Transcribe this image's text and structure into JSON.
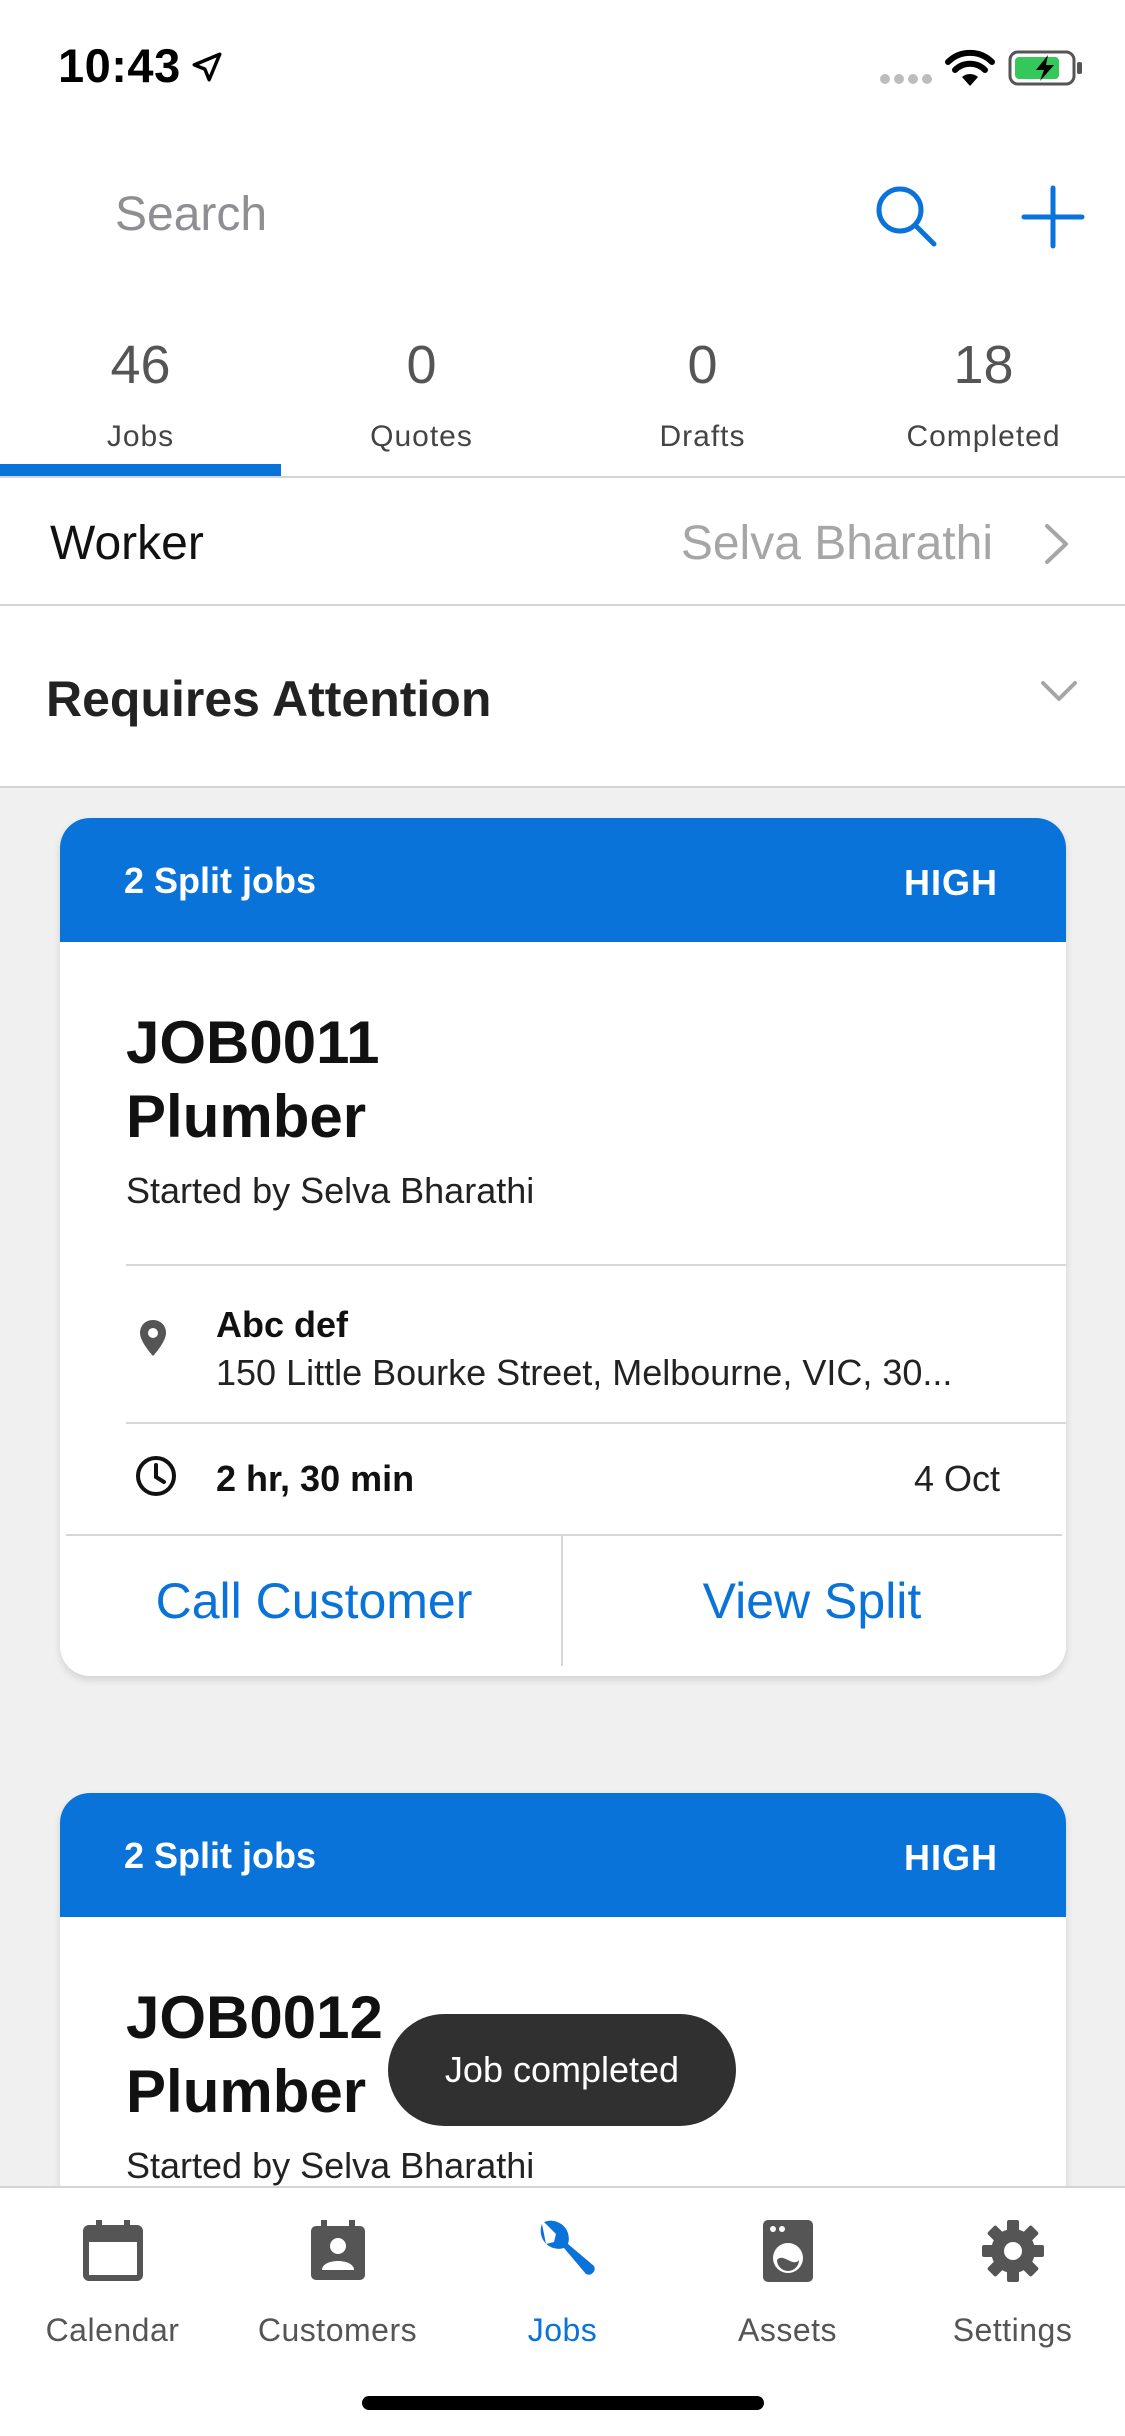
{
  "status_bar": {
    "time": "10:43"
  },
  "search": {
    "placeholder": "Search"
  },
  "tabs": [
    {
      "count": "46",
      "label": "Jobs",
      "active": true
    },
    {
      "count": "0",
      "label": "Quotes",
      "active": false
    },
    {
      "count": "0",
      "label": "Drafts",
      "active": false
    },
    {
      "count": "18",
      "label": "Completed",
      "active": false
    }
  ],
  "worker": {
    "label": "Worker",
    "value": "Selva Bharathi"
  },
  "attention": {
    "title": "Requires Attention"
  },
  "cards": [
    {
      "split_label": "2 Split jobs",
      "priority": "HIGH",
      "job_number": "JOB0011",
      "job_type": "Plumber",
      "started_by": "Started by Selva Bharathi",
      "customer_name": "Abc def",
      "address": "150 Little Bourke Street, Melbourne, VIC, 30...",
      "duration": "2 hr, 30 min",
      "date": "4 Oct",
      "call_label": "Call Customer",
      "view_label": "View Split"
    },
    {
      "split_label": "2 Split jobs",
      "priority": "HIGH",
      "job_number": "JOB0012",
      "job_type": "Plumber",
      "started_by": "Started by Selva Bharathi"
    }
  ],
  "toast": {
    "text": "Job completed"
  },
  "bottom_nav": [
    {
      "label": "Calendar",
      "icon": "calendar-icon",
      "active": false
    },
    {
      "label": "Customers",
      "icon": "customers-icon",
      "active": false
    },
    {
      "label": "Jobs",
      "icon": "wrench-icon",
      "active": true
    },
    {
      "label": "Assets",
      "icon": "washing-machine-icon",
      "active": false
    },
    {
      "label": "Settings",
      "icon": "gear-icon",
      "active": false
    }
  ],
  "colors": {
    "accent": "#0a73d9",
    "toast_bg": "#303030",
    "background": "#f0f0f0"
  }
}
